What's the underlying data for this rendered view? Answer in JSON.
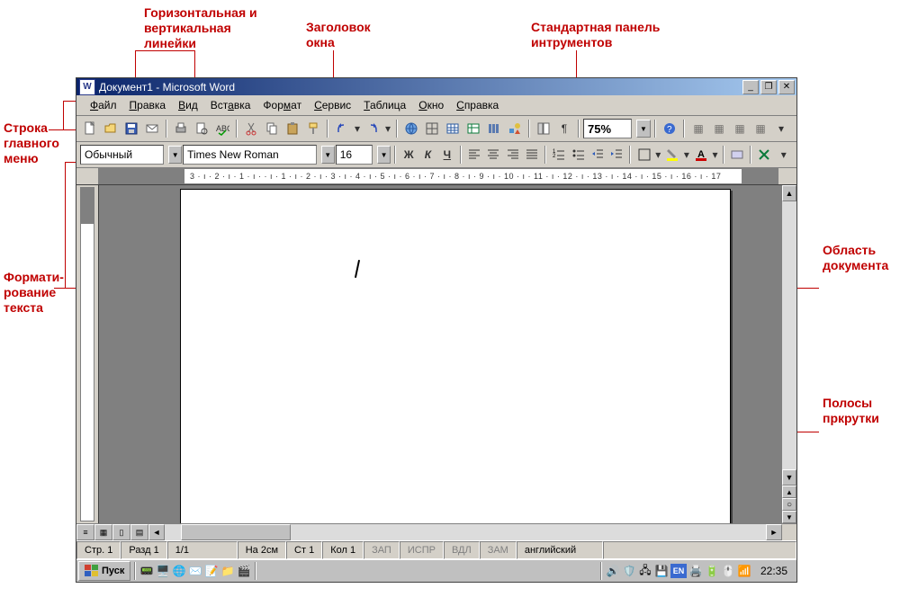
{
  "annotations": {
    "rulers": "Горизонтальная и\nвертикальная\nлинейки",
    "title_caption": "Заголовок\nокна",
    "std_toolbar": "Стандартная панель\nинтрументов",
    "main_menu": "Строка\nглавного\nменю",
    "formatting": "Формати-\nрование\nтекста",
    "doc_area": "Область\nдокумента",
    "scrollbars": "Полосы\nпркрутки"
  },
  "window": {
    "title": "Документ1 - Microsoft Word",
    "app_icon_letter": "W"
  },
  "menu": {
    "items": [
      "Файл",
      "Правка",
      "Вид",
      "Вставка",
      "Формат",
      "Сервис",
      "Таблица",
      "Окно",
      "Справка"
    ]
  },
  "standard_toolbar": {
    "zoom": "75%"
  },
  "format_toolbar": {
    "style": "Обычный",
    "font": "Times New Roman",
    "size": "16",
    "bold": "Ж",
    "italic": "К",
    "underline": "Ч"
  },
  "ruler": {
    "ticks": "3 · ı · 2 · ı · 1 · ı ·  · ı · 1 · ı · 2 · ı · 3 · ı · 4 · ı · 5 · ı · 6 · ı · 7 · ı · 8 · ı · 9 · ı · 10 · ı · 11 · ı · 12 · ı · 13 · ı · 14 · ı · 15 · ı · 16 · ı · 17"
  },
  "status": {
    "page": "Стр. 1",
    "section": "Разд 1",
    "pages": "1/1",
    "at": "На 2см",
    "line": "Ст 1",
    "col": "Кол 1",
    "rec": "ЗАП",
    "trk": "ИСПР",
    "ext": "ВДЛ",
    "ovr": "ЗАМ",
    "lang": "английский"
  },
  "taskbar": {
    "start": "Пуск",
    "lang_indicator": "EN",
    "time": "22:35"
  }
}
